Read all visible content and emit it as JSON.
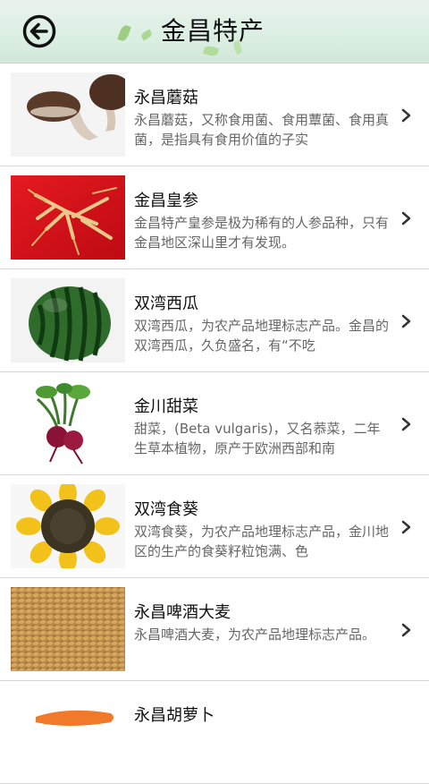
{
  "header": {
    "title": "金昌特产",
    "back_icon": "back-arrow-circle-icon"
  },
  "items": [
    {
      "title": "永昌蘑菇",
      "desc": "永昌蘑菇，又称食用菌、食用蕈菌、食用真菌，是指具有食用价值的子实"
    },
    {
      "title": "金昌皇参",
      "desc": "金昌特产皇参是极为稀有的人参品种，只有金昌地区深山里才有发现。"
    },
    {
      "title": "双湾西瓜",
      "desc": "双湾西瓜，为农产品地理标志产品。金昌的双湾西瓜，久负盛名，有“不吃"
    },
    {
      "title": "金川甜菜",
      "desc": "甜菜，(Beta vulgaris)，又名菾菜，二年生草本植物，原产于欧洲西部和南"
    },
    {
      "title": "双湾食葵",
      "desc": "双湾食葵，为农产品地理标志产品，金川地区的生产的食葵籽粒饱满、色"
    },
    {
      "title": "永昌啤酒大麦",
      "desc": "永昌啤酒大麦，为农产品地理标志产品。"
    },
    {
      "title": "永昌胡萝卜",
      "desc": ""
    }
  ],
  "colors": {
    "header_bg": "#dcefe3",
    "divider": "#d7d7d7",
    "title_text": "#111111",
    "desc_text": "#666666"
  }
}
